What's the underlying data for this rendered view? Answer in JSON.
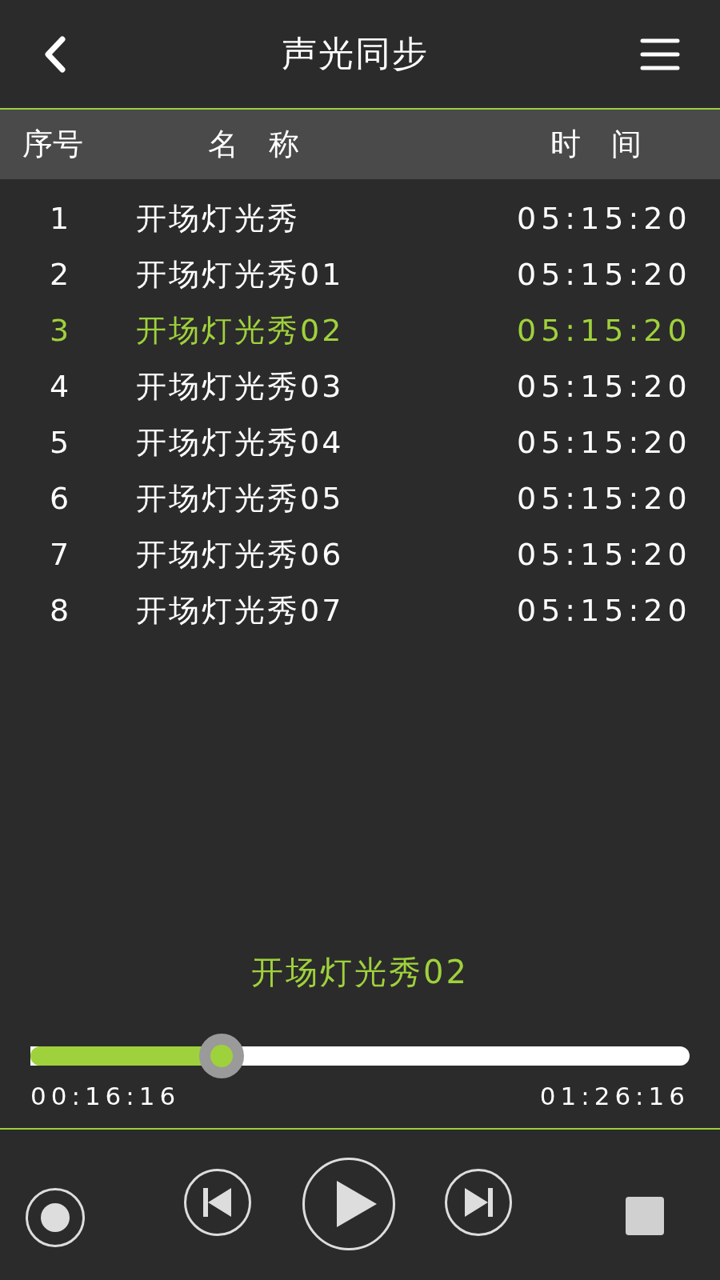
{
  "header": {
    "title": "声光同步"
  },
  "columns": [
    "序号",
    "名　称",
    "时　间"
  ],
  "rows": [
    {
      "index": "1",
      "name": "开场灯光秀",
      "time": "05:15:20",
      "selected": false
    },
    {
      "index": "2",
      "name": "开场灯光秀01",
      "time": "05:15:20",
      "selected": false
    },
    {
      "index": "3",
      "name": "开场灯光秀02",
      "time": "05:15:20",
      "selected": true
    },
    {
      "index": "4",
      "name": "开场灯光秀03",
      "time": "05:15:20",
      "selected": false
    },
    {
      "index": "5",
      "name": "开场灯光秀04",
      "time": "05:15:20",
      "selected": false
    },
    {
      "index": "6",
      "name": "开场灯光秀05",
      "time": "05:15:20",
      "selected": false
    },
    {
      "index": "7",
      "name": "开场灯光秀06",
      "time": "05:15:20",
      "selected": false
    },
    {
      "index": "8",
      "name": "开场灯光秀07",
      "time": "05:15:20",
      "selected": false
    }
  ],
  "player": {
    "now_playing": "开场灯光秀02",
    "level": 0.29,
    "elapsed": "00:16:16",
    "total": "01:26:16"
  }
}
